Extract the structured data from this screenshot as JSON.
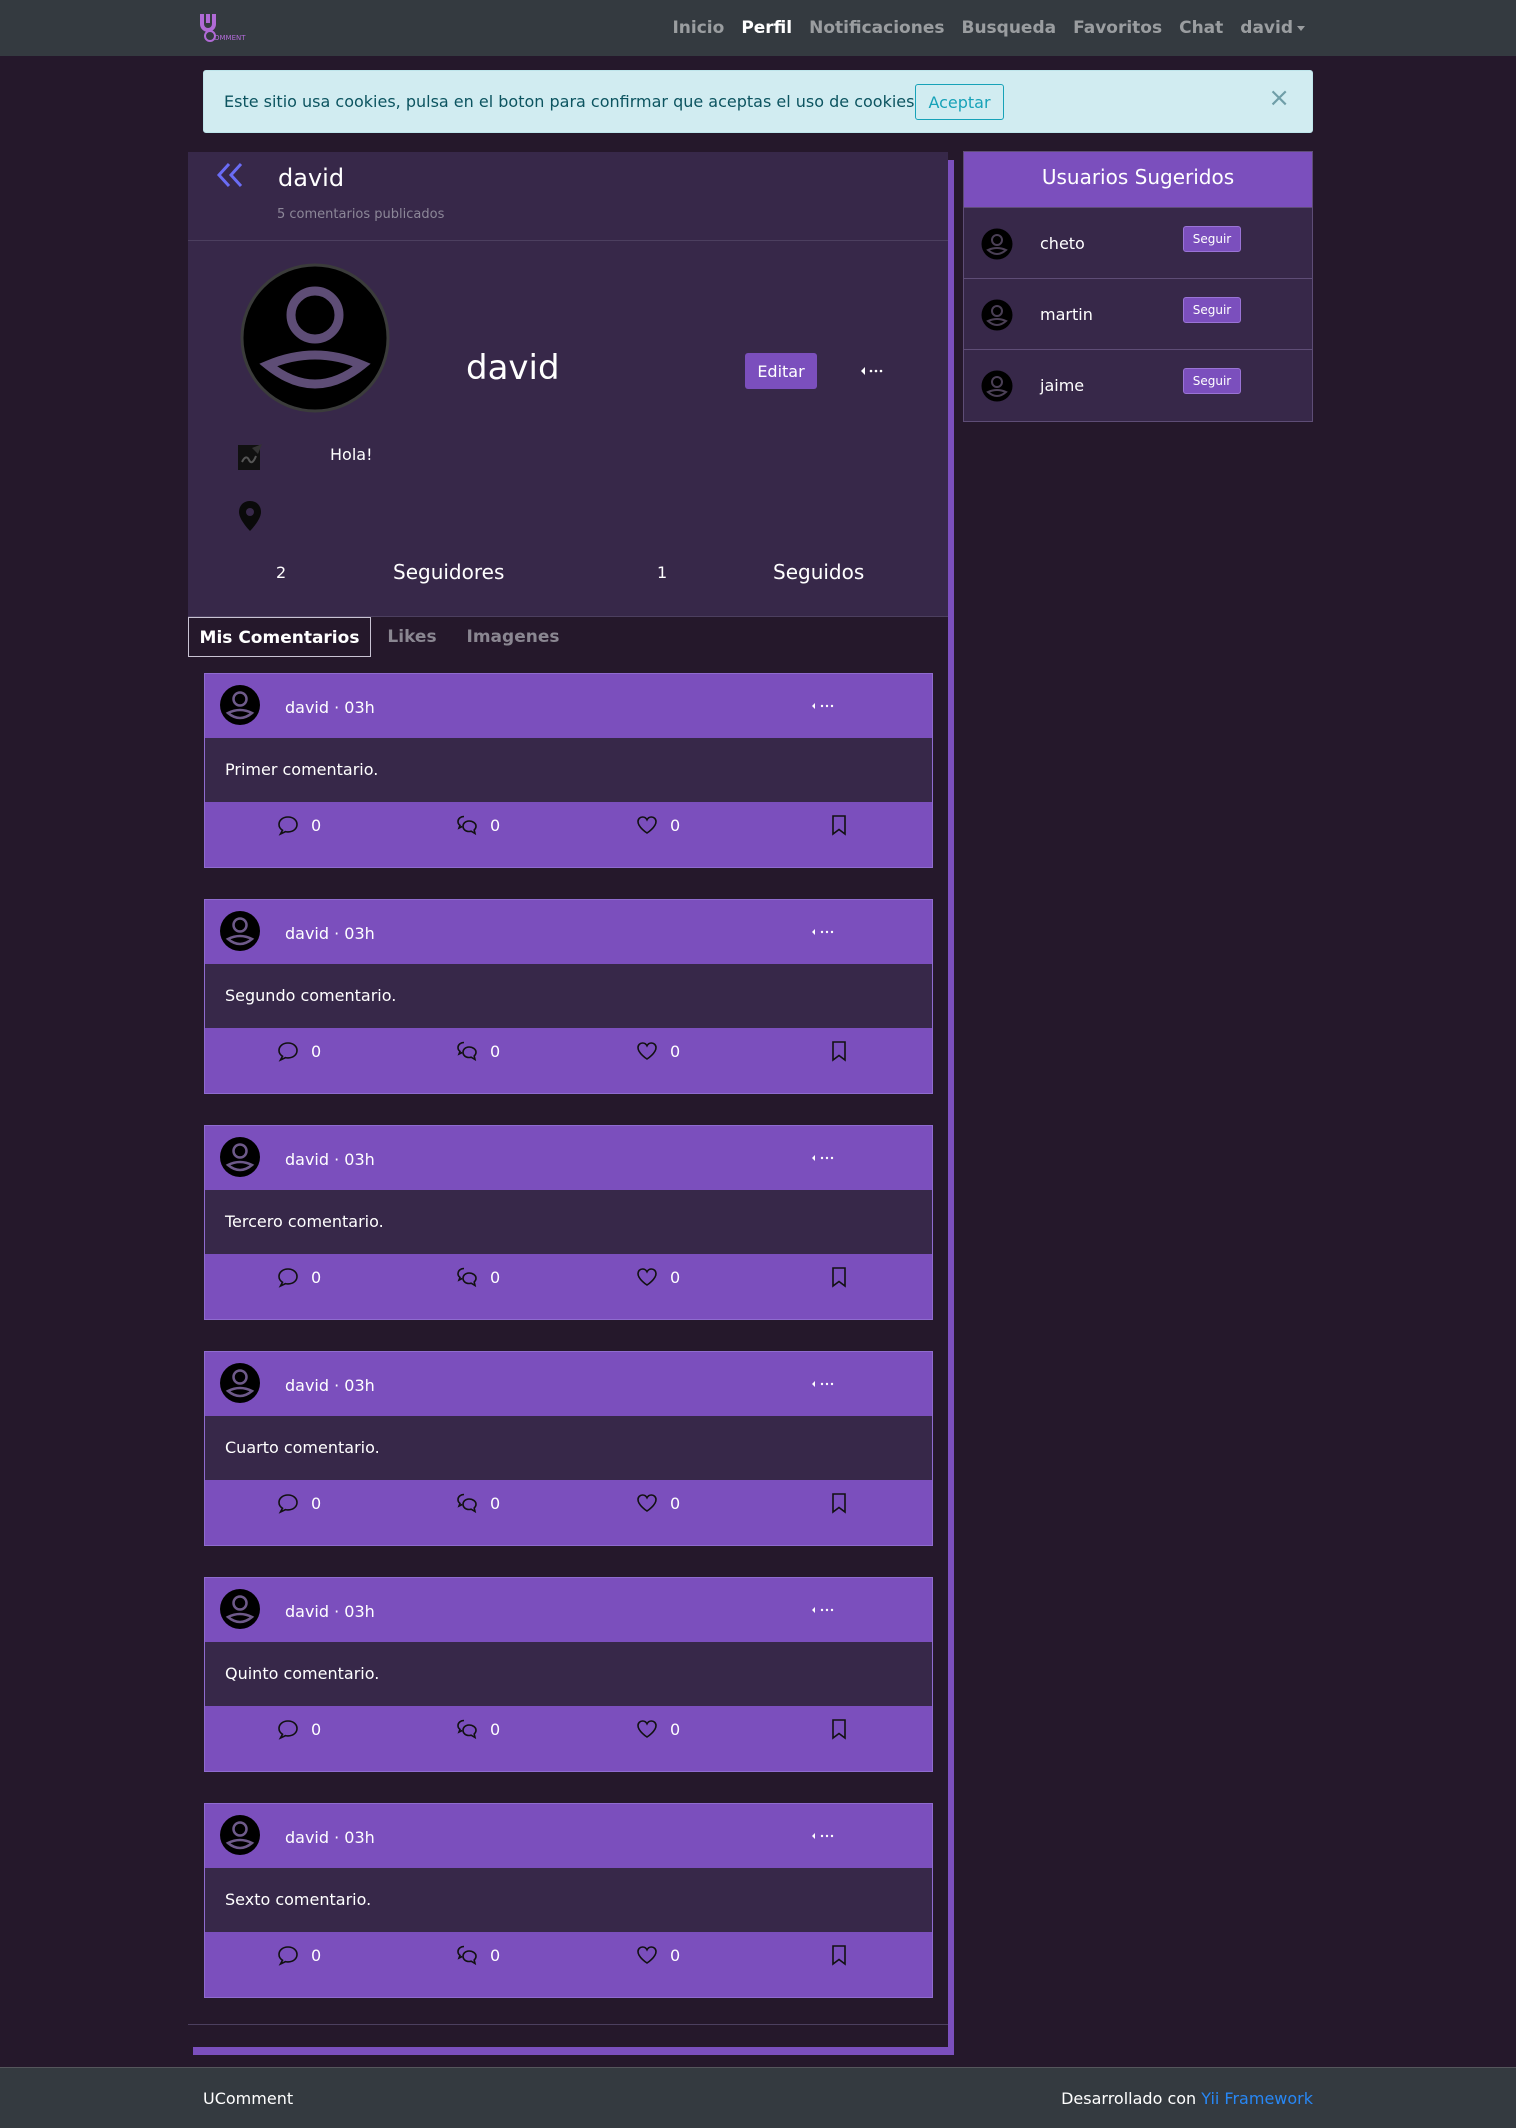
{
  "nav": {
    "links": [
      "Inicio",
      "Perfil",
      "Notificaciones",
      "Busqueda",
      "Favoritos",
      "Chat",
      "david"
    ]
  },
  "cookie": {
    "text": "Este sitio usa cookies, pulsa en el boton para confirmar que aceptas el uso de cookies",
    "button": "Aceptar",
    "close": "×"
  },
  "profile": {
    "header_name": "david",
    "comment_count": "5 comentarios publicados",
    "name": "david",
    "edit_label": "Editar",
    "bio": "Hola!",
    "followers_count": "2",
    "followers_label": "Seguidores",
    "following_count": "1",
    "following_label": "Seguidos"
  },
  "tabs": [
    "Mis Comentarios",
    "Likes",
    "Imagenes"
  ],
  "comments": [
    {
      "author": "david · 03h",
      "text": "Primer comentario.",
      "replies": "0",
      "quotes": "0",
      "likes": "0"
    },
    {
      "author": "david · 03h",
      "text": "Segundo comentario.",
      "replies": "0",
      "quotes": "0",
      "likes": "0"
    },
    {
      "author": "david · 03h",
      "text": "Tercero comentario.",
      "replies": "0",
      "quotes": "0",
      "likes": "0"
    },
    {
      "author": "david · 03h",
      "text": "Cuarto comentario.",
      "replies": "0",
      "quotes": "0",
      "likes": "0"
    },
    {
      "author": "david · 03h",
      "text": "Quinto comentario.",
      "replies": "0",
      "quotes": "0",
      "likes": "0"
    },
    {
      "author": "david · 03h",
      "text": "Sexto comentario.",
      "replies": "0",
      "quotes": "0",
      "likes": "0"
    }
  ],
  "sidebar": {
    "title": "Usuarios Sugeridos",
    "users": [
      {
        "name": "cheto",
        "button": "Seguir"
      },
      {
        "name": "martin",
        "button": "Seguir"
      },
      {
        "name": "jaime",
        "button": "Seguir"
      }
    ]
  },
  "footer": {
    "left": "UComment",
    "right_prefix": "Desarrollado con ",
    "right_link": "Yii Framework"
  },
  "colors": {
    "background": "#25182b",
    "panel": "#372849",
    "accent": "#7b4fbd",
    "navbar": "#343a40",
    "link": "#2787f5"
  }
}
